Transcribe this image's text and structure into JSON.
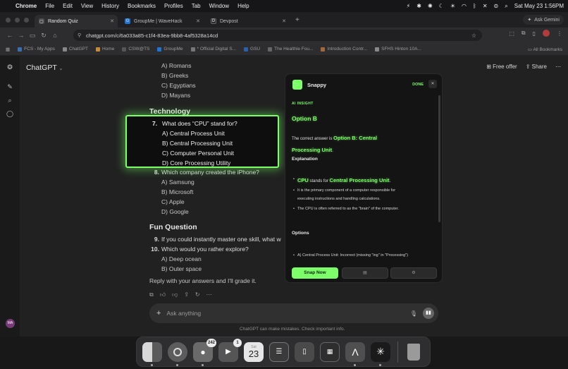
{
  "menubar": {
    "items": [
      "Chrome",
      "File",
      "Edit",
      "View",
      "History",
      "Bookmarks",
      "Profiles",
      "Tab",
      "Window",
      "Help"
    ],
    "datetime": "Sat May 23  1:56PM"
  },
  "tabs": [
    {
      "title": "Random Quiz",
      "fav": "▢",
      "color": "#4b4b4e"
    },
    {
      "title": "GroupMe | WaveHack",
      "fav": "G",
      "color": "#1d75d8"
    },
    {
      "title": "Devpost",
      "fav": "D",
      "color": "#2a2a2a"
    }
  ],
  "ask_gemini": "Ask Gemini",
  "url": "chatgpt.com/c/6a033a85-c1f4-83ea-9bb8-4af5328a14cd",
  "bookmarks": [
    "FCS - My Apps",
    "ChatGPT",
    "Home",
    "CSW@TS",
    "GroupMe",
    "* Official Digital S...",
    "GSU",
    "The Healthie Fou...",
    "Introduction Contr...",
    "SFHS Hinton 10A..."
  ],
  "all_bookmarks": "All Bookmarks",
  "header": {
    "title": "ChatGPT",
    "free_offer": "Free offer",
    "share": "Share"
  },
  "quiz": {
    "prev_options": [
      "A) Romans",
      "B) Greeks",
      "C) Egyptians",
      "D) Mayans"
    ],
    "section_tech": "Technology",
    "q7": {
      "num": "7.",
      "text": "What does “CPU” stand for?",
      "options": [
        "A) Central Process Unit",
        "B) Central Processing Unit",
        "C) Computer Personal Unit",
        "D) Core Processing Utility"
      ]
    },
    "q8": {
      "num": "8.",
      "text": "Which company created the iPhone?",
      "options": [
        "A) Samsung",
        "B) Microsoft",
        "C) Apple",
        "D) Google"
      ]
    },
    "section_fun": "Fun Question",
    "q9": {
      "num": "9.",
      "text": "If you could instantly master one skill, what w"
    },
    "q10": {
      "num": "10.",
      "text": "Which would you rather explore?",
      "options": [
        "A) Deep ocean",
        "B) Outer space"
      ]
    },
    "reply": "Reply with your answers and I'll grade it."
  },
  "composer": {
    "placeholder": "Ask anything",
    "disclaimer": "ChatGPT can make mistakes. Check important info."
  },
  "user_initials": "MA",
  "snappy": {
    "name": "Snappy",
    "done": "DONE",
    "insight_cap": "AI INSIGHT",
    "answer": "Option B",
    "correct_prefix": "The correct answer is ",
    "correct_green_1": "Option B: Central",
    "correct_green_2": "Processing Unit",
    "period": ".",
    "explanation_h": "Explanation",
    "cpu": "CPU",
    "stands_for": " stands for ",
    "cpu_full": "Central Processing Unit",
    "bullet2_l1": "It is the primary component of a computer responsible for",
    "bullet2_l2": "executing instructions and handling calculations.",
    "bullet3": "The CPU is often referred to as the \"brain\" of the computer.",
    "options_h": "Options",
    "option_a": "A) Central Process Unit: Incorrect (missing \"ing\" in \"Processing\")",
    "snap_now": "Snap Now"
  },
  "dock": {
    "messages_badge": "242",
    "facetime_badge": "1",
    "calendar_day": "23",
    "calendar_month": "Sat"
  }
}
